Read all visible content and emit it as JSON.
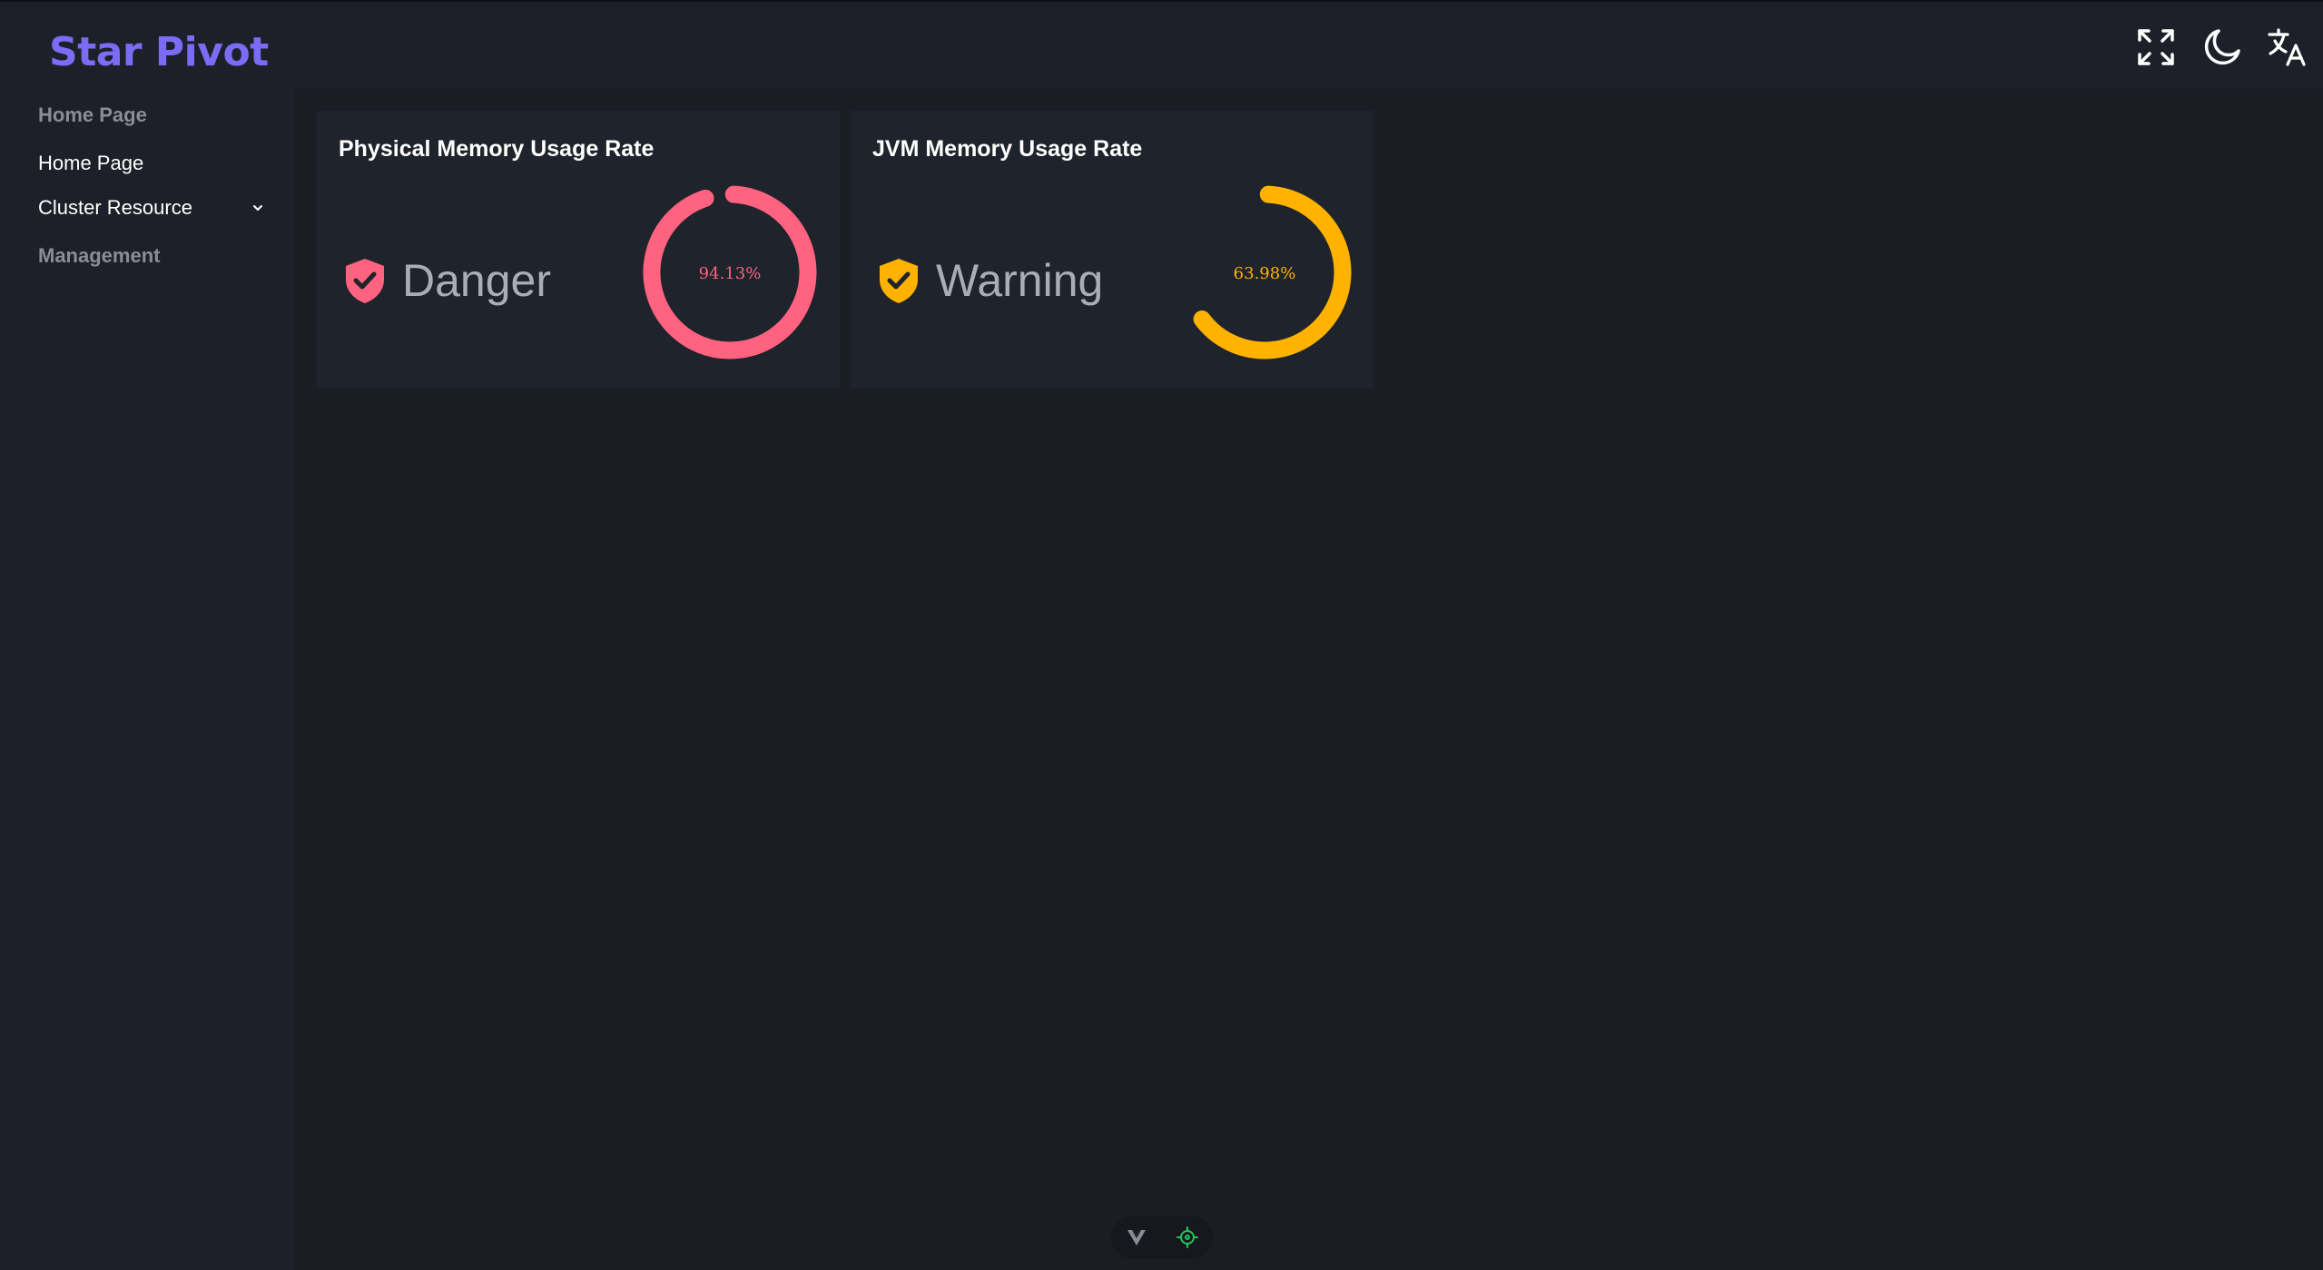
{
  "brand": {
    "name": "Star Pivot",
    "color": "#7b6cf6"
  },
  "sidebar": {
    "groups": [
      {
        "label": "Home Page"
      },
      {
        "label": "Management"
      }
    ],
    "items": [
      {
        "label": "Home Page",
        "icon": "none"
      },
      {
        "label": "Cluster Resource",
        "icon": "chevron-down-icon"
      }
    ]
  },
  "header": {
    "icons": [
      "fullscreen-icon",
      "moon-icon",
      "translate-icon"
    ]
  },
  "cards": [
    {
      "title": "Physical Memory Usage Rate",
      "status": "Danger",
      "value_label": "94.13%",
      "value": 94.13,
      "color": "#ff637f",
      "icon": "shield-check-icon"
    },
    {
      "title": "JVM Memory Usage Rate",
      "status": "Warning",
      "value_label": "63.98%",
      "value": 63.98,
      "color": "#ffb300",
      "icon": "shield-check-icon"
    }
  ],
  "devtools": {
    "icons": [
      "vue-icon",
      "crosshair-icon"
    ],
    "accent": "#22c55e"
  }
}
